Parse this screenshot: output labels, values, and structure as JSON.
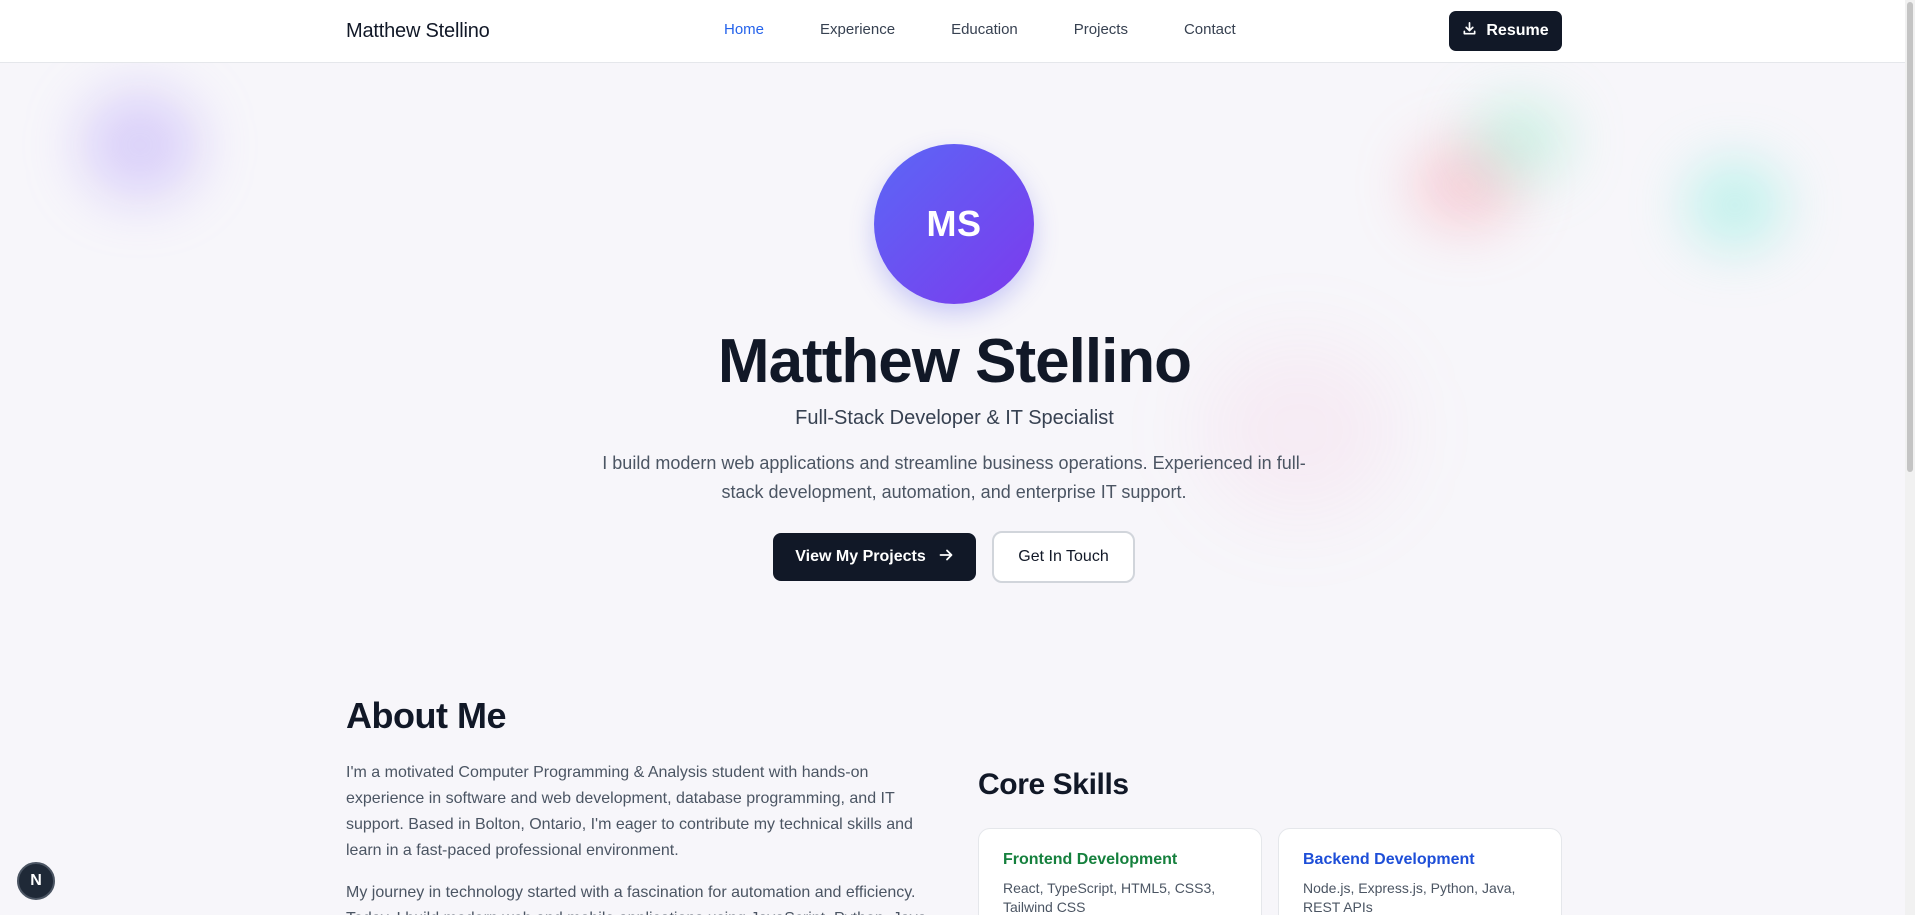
{
  "nav": {
    "brand": "Matthew Stellino",
    "links": [
      "Home",
      "Experience",
      "Education",
      "Projects",
      "Contact"
    ],
    "active_link": "Home",
    "resume_label": "Resume",
    "resume_icon": "download-icon"
  },
  "hero": {
    "initials": "MS",
    "name": "Matthew Stellino",
    "role": "Full-Stack Developer & IT Specialist",
    "description": "I build modern web applications and streamline business operations. Experienced in full-stack development, automation, and enterprise IT support.",
    "primary_button": "View My Projects",
    "primary_icon": "arrow-right-icon",
    "secondary_button": "Get In Touch"
  },
  "about": {
    "title": "About Me",
    "paragraphs": [
      "I'm a motivated Computer Programming & Analysis student with hands-on experience in software and web development, database programming, and IT support. Based in Bolton, Ontario, I'm eager to contribute my technical skills and learn in a fast-paced professional environment.",
      "My journey in technology started with a fascination for automation and efficiency. Today, I build modern web and mobile applications using JavaScript, Python, Java"
    ]
  },
  "skills": {
    "title": "Core Skills",
    "cards": [
      {
        "name": "Frontend Development",
        "items": "React, TypeScript, HTML5, CSS3, Tailwind CSS"
      },
      {
        "name": "Backend Development",
        "items": "Node.js, Express.js, Python, Java, REST APIs"
      }
    ]
  },
  "dev_badge": "N",
  "colors": {
    "accent": "#2563eb",
    "dark": "#111827",
    "avatar_gradient_start": "#5b67f6",
    "avatar_gradient_end": "#7c3aed",
    "frontend": "#15803d",
    "backend": "#1d4ed8"
  }
}
